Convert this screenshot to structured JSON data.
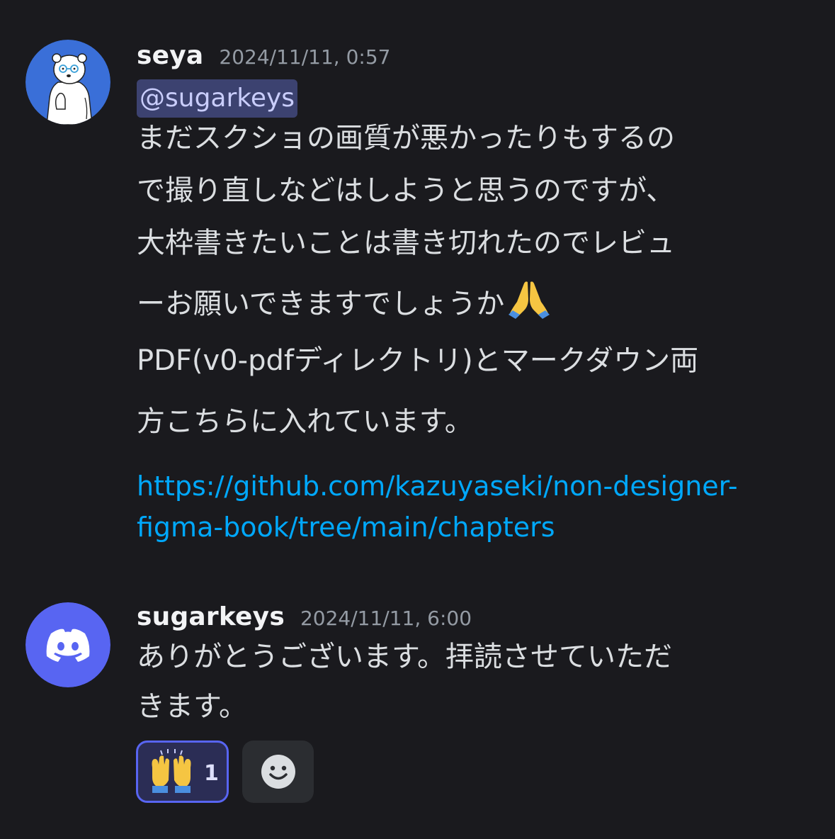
{
  "messages": [
    {
      "username": "seya",
      "timestamp": "2024/11/11, 0:57",
      "avatar_icon": "polar-bear-avatar",
      "mention": "@sugarkeys",
      "lines": [
        "まだスクショの画質が悪かったりもするの",
        "で撮り直しなどはしようと思うのですが、",
        "大枠書きたいことは書き切れたのでレビュ",
        "ーお願いできますでしょうか"
      ],
      "emoji_icon": "folded-hands-emoji",
      "lines2": [
        "PDF(v0-pdfディレクトリ)とマークダウン両",
        "方こちらに入れています。"
      ],
      "link_lines": [
        "https://github.com/kazuyaseki/non-designer-",
        "figma-book/tree/main/chapters"
      ]
    },
    {
      "username": "sugarkeys",
      "timestamp": "2024/11/11, 6:00",
      "avatar_icon": "discord-logo-avatar",
      "lines": [
        "ありがとうございます。拝読させていただ",
        "きます。"
      ],
      "reactions": [
        {
          "emoji_icon": "raising-hands-emoji",
          "count": "1"
        }
      ],
      "add_reaction_icon": "add-reaction-smiley-icon"
    }
  ],
  "colors": {
    "background": "#1a1a1e",
    "link": "#00a8fc",
    "mention_bg": "#3c4270",
    "discord_blurple": "#5865f2",
    "avatar_blue": "#3a6fd8"
  }
}
